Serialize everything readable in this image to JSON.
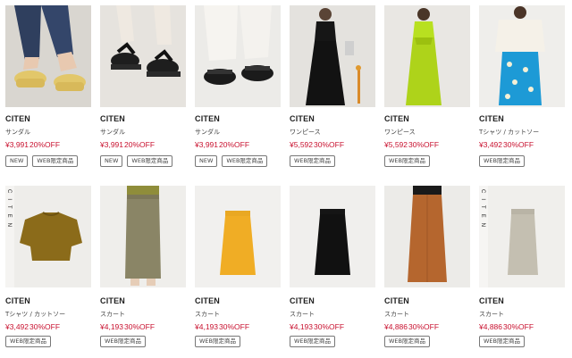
{
  "colors": {
    "price": "#c8102e",
    "text": "#222222",
    "tag_border": "#777777"
  },
  "products": [
    {
      "brand": "CITEN",
      "category": "サンダル",
      "price": "¥3,991",
      "discount": "20%OFF",
      "tags": [
        "NEW",
        "WEB限定商品"
      ],
      "image": "photo-yellow-platform-sandals"
    },
    {
      "brand": "CITEN",
      "category": "サンダル",
      "price": "¥3,991",
      "discount": "20%OFF",
      "tags": [
        "NEW",
        "WEB限定商品"
      ],
      "image": "photo-black-thong-sandals"
    },
    {
      "brand": "CITEN",
      "category": "サンダル",
      "price": "¥3,991",
      "discount": "20%OFF",
      "tags": [
        "NEW",
        "WEB限定商品"
      ],
      "image": "photo-black-strap-sandals"
    },
    {
      "brand": "CITEN",
      "category": "ワンピース",
      "price": "¥5,592",
      "discount": "30%OFF",
      "tags": [
        "WEB限定商品"
      ],
      "image": "photo-black-dress"
    },
    {
      "brand": "CITEN",
      "category": "ワンピース",
      "price": "¥5,592",
      "discount": "30%OFF",
      "tags": [
        "WEB限定商品"
      ],
      "image": "photo-lime-dress"
    },
    {
      "brand": "CITEN",
      "category": "Tシャツ / カットソー",
      "price": "¥3,492",
      "discount": "30%OFF",
      "tags": [
        "WEB限定商品"
      ],
      "image": "photo-white-top-blue-skirt"
    },
    {
      "brand": "CITEN",
      "category": "Tシャツ / カットソー",
      "price": "¥3,492",
      "discount": "30%OFF",
      "tags": [
        "WEB限定商品"
      ],
      "image": "photo-olive-top",
      "side_text": "CITEN"
    },
    {
      "brand": "CITEN",
      "category": "スカート",
      "price": "¥4,193",
      "discount": "30%OFF",
      "tags": [
        "WEB限定商品"
      ],
      "image": "photo-khaki-skirt"
    },
    {
      "brand": "CITEN",
      "category": "スカート",
      "price": "¥4,193",
      "discount": "30%OFF",
      "tags": [
        "WEB限定商品"
      ],
      "image": "photo-yellow-skirt"
    },
    {
      "brand": "CITEN",
      "category": "スカート",
      "price": "¥4,193",
      "discount": "30%OFF",
      "tags": [
        "WEB限定商品"
      ],
      "image": "photo-black-skirt"
    },
    {
      "brand": "CITEN",
      "category": "スカート",
      "price": "¥4,886",
      "discount": "30%OFF",
      "tags": [
        "WEB限定商品"
      ],
      "image": "photo-brown-skirt"
    },
    {
      "brand": "CITEN",
      "category": "スカート",
      "price": "¥4,886",
      "discount": "30%OFF",
      "tags": [
        "WEB限定商品"
      ],
      "image": "photo-grey-skirt",
      "side_text": "CITEN"
    }
  ]
}
